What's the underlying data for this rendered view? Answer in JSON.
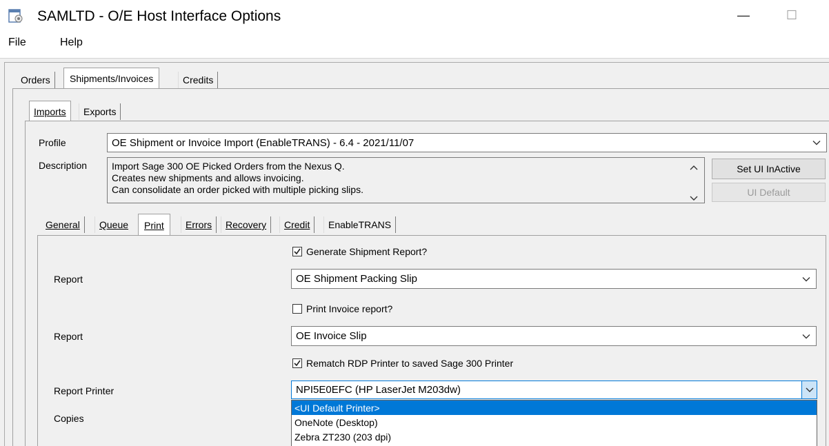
{
  "window": {
    "title": "SAMLTD - O/E Host Interface Options",
    "minimize_glyph": "—",
    "maximize_glyph": "☐"
  },
  "menu": {
    "items": [
      "File",
      "Help"
    ]
  },
  "main_tabs": [
    {
      "label": "Orders",
      "selected": false
    },
    {
      "label": "Shipments/Invoices",
      "selected": true
    },
    {
      "label": "Credits",
      "selected": false
    }
  ],
  "sub_tabs": [
    {
      "label": "Imports",
      "selected": true
    },
    {
      "label": "Exports",
      "selected": false
    }
  ],
  "profile": {
    "label": "Profile",
    "value": "OE Shipment or Invoice Import (EnableTRANS) - 6.4 - 2021/11/07"
  },
  "description": {
    "label": "Description",
    "lines": [
      "Import Sage 300 OE Picked Orders from the Nexus Q.",
      "Creates new shipments and allows invoicing.",
      "Can consolidate an order picked with multiple picking slips."
    ]
  },
  "buttons": {
    "set_inactive": "Set UI InActive",
    "ui_default": "UI Default"
  },
  "inner_tabs": [
    {
      "label": "General",
      "selected": false
    },
    {
      "label": "Queue",
      "selected": false
    },
    {
      "label": "Print",
      "selected": true
    },
    {
      "label": "Errors",
      "selected": false
    },
    {
      "label": "Recovery",
      "selected": false
    },
    {
      "label": "Credit",
      "selected": false
    },
    {
      "label": "EnableTRANS",
      "selected": false
    }
  ],
  "print_tab": {
    "generate_shipment": {
      "label": "Generate Shipment Report?",
      "checked": true
    },
    "report1": {
      "label": "Report",
      "value": "OE Shipment Packing Slip"
    },
    "print_invoice": {
      "label": "Print Invoice report?",
      "checked": false
    },
    "report2": {
      "label": "Report",
      "value": "OE Invoice Slip"
    },
    "rematch": {
      "label": "Rematch RDP Printer to saved Sage 300 Printer",
      "checked": true
    },
    "report_printer": {
      "label": "Report Printer",
      "value": "NPI5E0EFC (HP LaserJet M203dw)"
    },
    "copies": {
      "label": "Copies"
    },
    "printer_options": [
      "<UI Default Printer>",
      "OneNote (Desktop)",
      "Zebra ZT230 (203 dpi)"
    ],
    "highlighted_option": "<UI Default Printer>"
  },
  "colors": {
    "highlight": "#0078d7",
    "background": "#f0f0f0"
  }
}
